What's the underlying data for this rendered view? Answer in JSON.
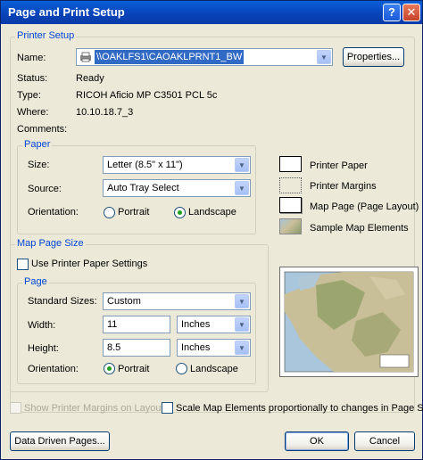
{
  "window": {
    "title": "Page and Print Setup"
  },
  "printer_setup": {
    "group_label": "Printer Setup",
    "name_label": "Name:",
    "name_value": "\\\\OAKLFS1\\CAOAKLPRNT1_BW",
    "properties_button": "Properties...",
    "status_label": "Status:",
    "status_value": "Ready",
    "type_label": "Type:",
    "type_value": "RICOH Aficio MP C3501 PCL 5c",
    "where_label": "Where:",
    "where_value": "10.10.18.7_3",
    "comments_label": "Comments:",
    "comments_value": ""
  },
  "paper": {
    "group_label": "Paper",
    "size_label": "Size:",
    "size_value": "Letter (8.5\" x 11\")",
    "source_label": "Source:",
    "source_value": "Auto Tray Select",
    "orientation_label": "Orientation:",
    "portrait_label": "Portrait",
    "landscape_label": "Landscape",
    "orientation_selected": "Landscape"
  },
  "legend": {
    "printer_paper": "Printer Paper",
    "printer_margins": "Printer Margins",
    "map_page": "Map Page (Page Layout)",
    "sample_elements": "Sample Map Elements"
  },
  "map_page_size": {
    "group_label": "Map Page Size",
    "use_printer_paper_label": "Use Printer Paper Settings",
    "use_printer_paper_checked": false,
    "page_group_label": "Page",
    "standard_sizes_label": "Standard Sizes:",
    "standard_sizes_value": "Custom",
    "width_label": "Width:",
    "width_value": "11",
    "width_units": "Inches",
    "height_label": "Height:",
    "height_value": "8.5",
    "height_units": "Inches",
    "orientation_label": "Orientation:",
    "portrait_label": "Portrait",
    "landscape_label": "Landscape",
    "orientation_selected": "Portrait"
  },
  "options": {
    "show_margins_label": "Show Printer Margins on Layout",
    "scale_elements_label": "Scale Map Elements proportionally to changes in Page Size"
  },
  "buttons": {
    "data_driven_pages": "Data Driven Pages...",
    "ok": "OK",
    "cancel": "Cancel"
  },
  "colors": {
    "title_bar": "#0844b9",
    "group_label": "#0046d5",
    "dialog_bg": "#ece9d8",
    "selection": "#316ac5"
  }
}
